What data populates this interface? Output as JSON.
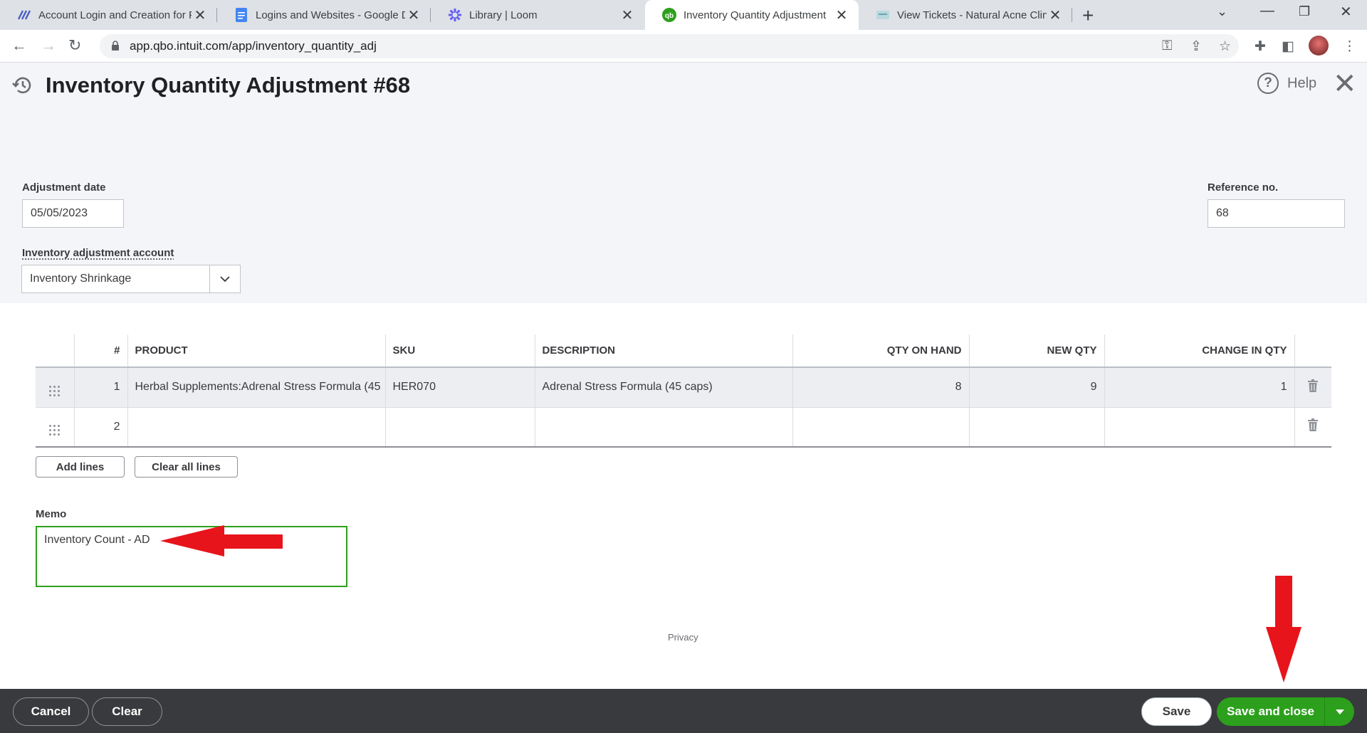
{
  "browser": {
    "tabs": [
      {
        "title": "Account Login and Creation for F",
        "icon": "airtable-icon",
        "active": false
      },
      {
        "title": "Logins and Websites - Google Dc",
        "icon": "google-docs-icon",
        "active": false
      },
      {
        "title": "Library | Loom",
        "icon": "loom-icon",
        "active": false
      },
      {
        "title": "Inventory Quantity Adjustment",
        "icon": "quickbooks-icon",
        "active": true
      },
      {
        "title": "View Tickets - Natural Acne Clinic",
        "icon": "site-icon",
        "active": false
      }
    ],
    "url": "app.qbo.intuit.com/app/inventory_quantity_adj"
  },
  "header": {
    "title": "Inventory Quantity Adjustment #68",
    "help_label": "Help"
  },
  "form": {
    "adjustment_date_label": "Adjustment date",
    "adjustment_date": "05/05/2023",
    "reference_label": "Reference no.",
    "reference_no": "68",
    "account_label": "Inventory adjustment account",
    "account_value": "Inventory Shrinkage"
  },
  "table": {
    "columns": [
      "#",
      "PRODUCT",
      "SKU",
      "DESCRIPTION",
      "QTY ON HAND",
      "NEW QTY",
      "CHANGE IN QTY"
    ],
    "rows": [
      {
        "num": "1",
        "product": "Herbal Supplements:Adrenal Stress Formula (45",
        "sku": "HER070",
        "description": "Adrenal Stress Formula (45 caps)",
        "qty_on_hand": "8",
        "new_qty": "9",
        "change": "1"
      },
      {
        "num": "2",
        "product": "",
        "sku": "",
        "description": "",
        "qty_on_hand": "",
        "new_qty": "",
        "change": ""
      }
    ],
    "add_lines_label": "Add lines",
    "clear_all_lines_label": "Clear all lines"
  },
  "memo": {
    "label": "Memo",
    "value": "Inventory Count - AD"
  },
  "privacy_link": "Privacy",
  "footer": {
    "cancel_label": "Cancel",
    "clear_label": "Clear",
    "save_label": "Save",
    "save_close_label": "Save and close"
  },
  "colors": {
    "brand_green": "#2ca01c",
    "footer_bg": "#393a3d",
    "annotation_red": "#e8141b"
  }
}
